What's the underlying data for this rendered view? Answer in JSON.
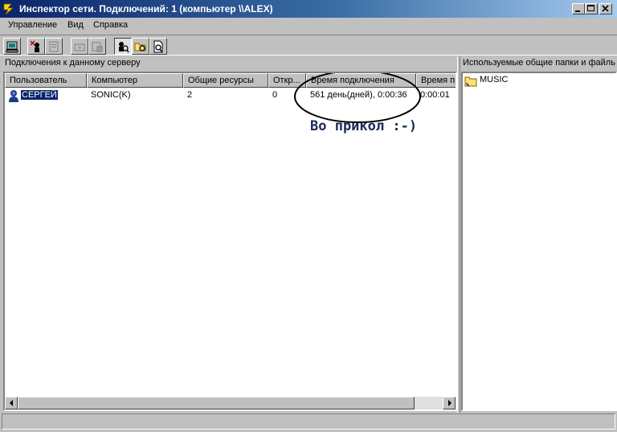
{
  "window": {
    "title": "Инспектор сети. Подключений: 1 (компьютер \\\\ALEX)",
    "buttons": [
      "minimize-icon",
      "maximize-icon",
      "close-icon"
    ]
  },
  "menu": [
    "Управление",
    "Вид",
    "Справка"
  ],
  "toolbar": {
    "icons": [
      "computer-icon",
      "disconnect-user-icon",
      "properties-icon",
      "share-icon",
      "share-properties-icon",
      "users-view-icon",
      "shared-folders-view-icon",
      "open-files-view-icon"
    ]
  },
  "left_pane": {
    "label": "Подключения к данному серверу",
    "columns": [
      "Пользователь",
      "Компьютер",
      "Общие ресурсы",
      "Откр...",
      "Время подключения",
      "Время пр"
    ],
    "rows": [
      {
        "user": "СЕРГЕЙ",
        "computer": "SONIC(K)",
        "shares": "2",
        "open": "0",
        "connect_time": "561 день(дней), 0:00:36",
        "idle_time": "0:00:01"
      }
    ],
    "annotation": "Во прикол :-)"
  },
  "right_pane": {
    "label": "Используемые общие папки и файлы",
    "items": [
      {
        "name": "MUSIC",
        "icon": "folder-icon"
      }
    ]
  },
  "colors": {
    "titlebar_start": "#0a246a",
    "selection": "#0a246a",
    "annotation": "#1a2a5a"
  }
}
